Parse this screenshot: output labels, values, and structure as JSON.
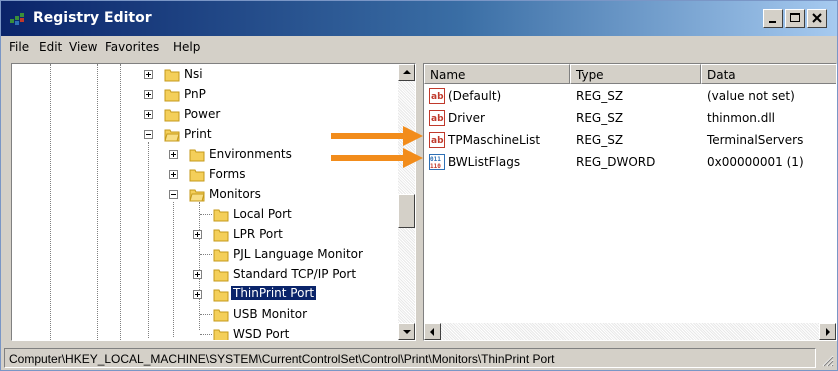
{
  "window": {
    "title": "Registry Editor"
  },
  "menu": [
    "File",
    "Edit",
    "View",
    "Favorites",
    "Help"
  ],
  "tree": {
    "items": [
      {
        "label": "Nsi",
        "level": 0,
        "expander": "plus"
      },
      {
        "label": "PnP",
        "level": 0,
        "expander": "plus"
      },
      {
        "label": "Power",
        "level": 0,
        "expander": "plus"
      },
      {
        "label": "Print",
        "level": 0,
        "expander": "minus"
      },
      {
        "label": "Environments",
        "level": 1,
        "expander": "plus"
      },
      {
        "label": "Forms",
        "level": 1,
        "expander": "plus"
      },
      {
        "label": "Monitors",
        "level": 1,
        "expander": "minus"
      },
      {
        "label": "Local Port",
        "level": 2,
        "expander": "none"
      },
      {
        "label": "LPR Port",
        "level": 2,
        "expander": "plus"
      },
      {
        "label": "PJL Language Monitor",
        "level": 2,
        "expander": "none"
      },
      {
        "label": "Standard TCP/IP Port",
        "level": 2,
        "expander": "plus"
      },
      {
        "label": "ThinPrint Port",
        "level": 2,
        "expander": "plus",
        "selected": true
      },
      {
        "label": "USB Monitor",
        "level": 2,
        "expander": "none"
      },
      {
        "label": "WSD Port",
        "level": 2,
        "expander": "none"
      }
    ]
  },
  "list": {
    "columns": [
      "Name",
      "Type",
      "Data"
    ],
    "rows": [
      {
        "name": "(Default)",
        "type": "REG_SZ",
        "data": "(value not set)",
        "icon": "string-value-icon"
      },
      {
        "name": "Driver",
        "type": "REG_SZ",
        "data": "thinmon.dll",
        "icon": "string-value-icon"
      },
      {
        "name": "TPMaschineList",
        "type": "REG_SZ",
        "data": "TerminalServers",
        "icon": "string-value-icon"
      },
      {
        "name": "BWListFlags",
        "type": "REG_DWORD",
        "data": "0x00000001 (1)",
        "icon": "dword-value-icon"
      }
    ]
  },
  "status": {
    "path": "Computer\\HKEY_LOCAL_MACHINE\\SYSTEM\\CurrentControlSet\\Control\\Print\\Monitors\\ThinPrint Port"
  },
  "colors": {
    "callout_arrow": "#f28c1b",
    "title_start": "#0a246a",
    "title_end": "#a6caf0",
    "selection": "#0a246a"
  }
}
